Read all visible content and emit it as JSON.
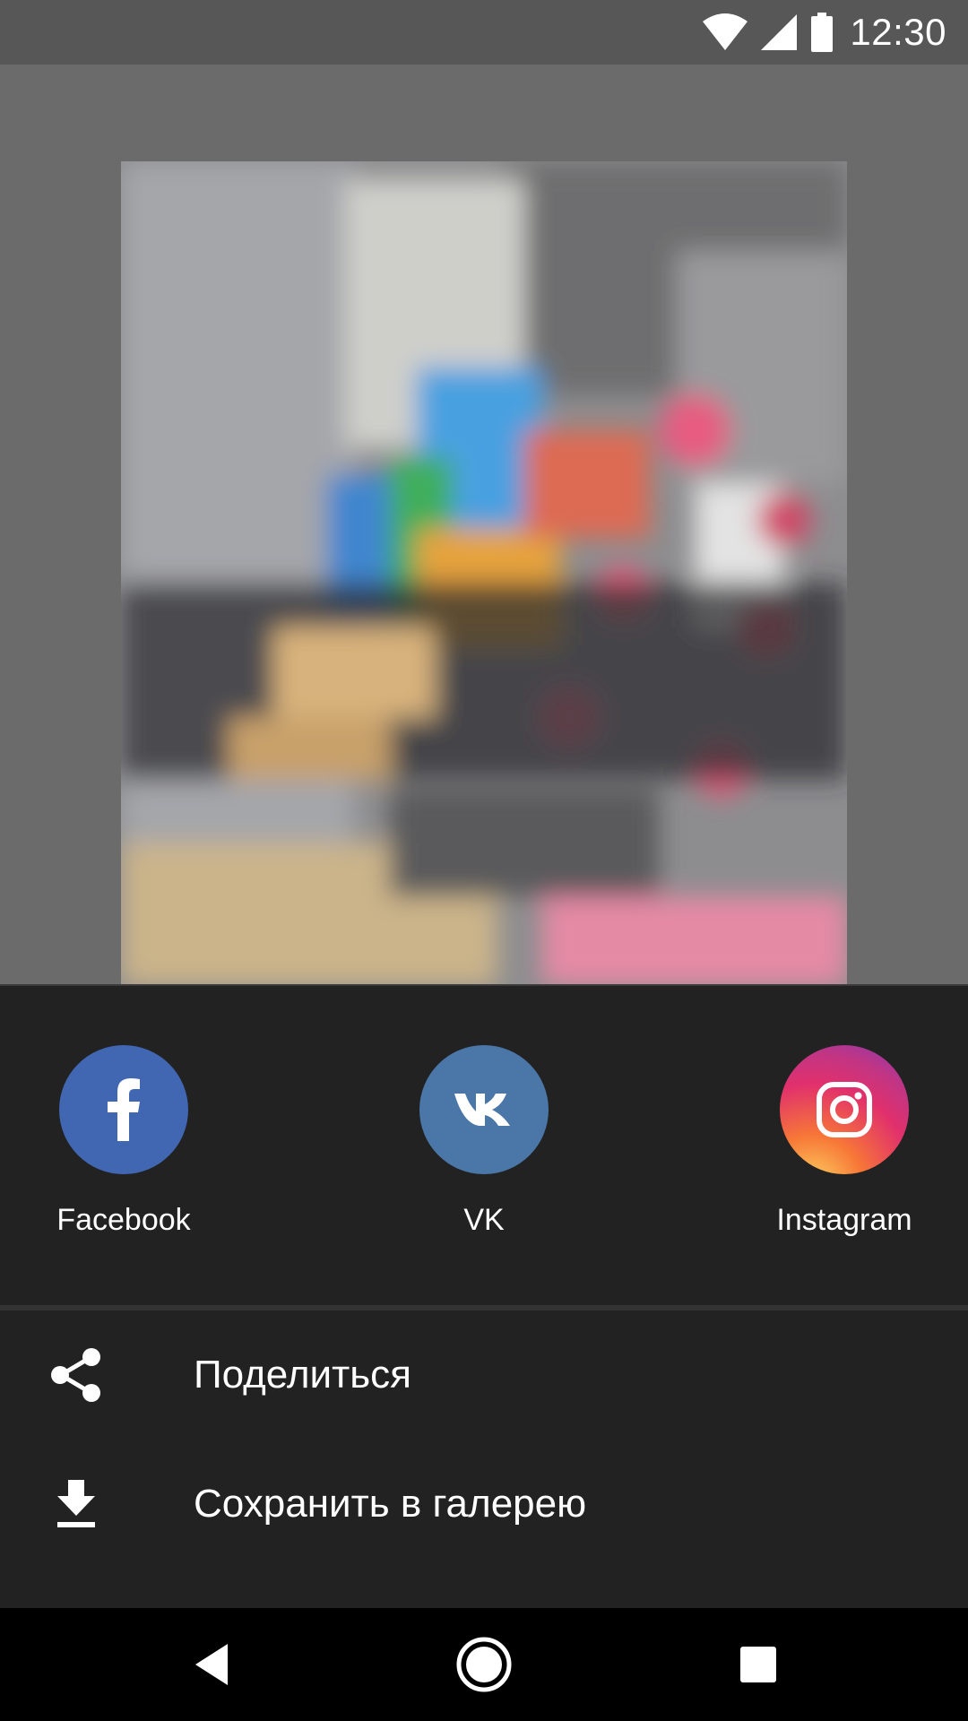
{
  "status_bar": {
    "time": "12:30",
    "icons": [
      "wifi-icon",
      "cellular-signal-icon",
      "battery-icon"
    ]
  },
  "preview": {
    "description_icon": "blurred-photo"
  },
  "share_sheet": {
    "apps": [
      {
        "label": "Facebook",
        "icon": "facebook-icon",
        "color": "#4267b2"
      },
      {
        "label": "VK",
        "icon": "vk-icon",
        "color": "#4a76a8"
      },
      {
        "label": "Instagram",
        "icon": "instagram-icon",
        "color": "#e1306c"
      }
    ],
    "actions": [
      {
        "label": "Поделиться",
        "icon": "share-icon"
      },
      {
        "label": "Сохранить в галерею",
        "icon": "download-icon"
      }
    ]
  },
  "nav_bar": {
    "buttons": [
      "back-icon",
      "home-icon",
      "recents-icon"
    ]
  },
  "colors": {
    "status_bar_bg": "#575757",
    "screen_bg": "#6b6b6b",
    "sheet_bg": "#222222",
    "nav_bg": "#000000"
  }
}
